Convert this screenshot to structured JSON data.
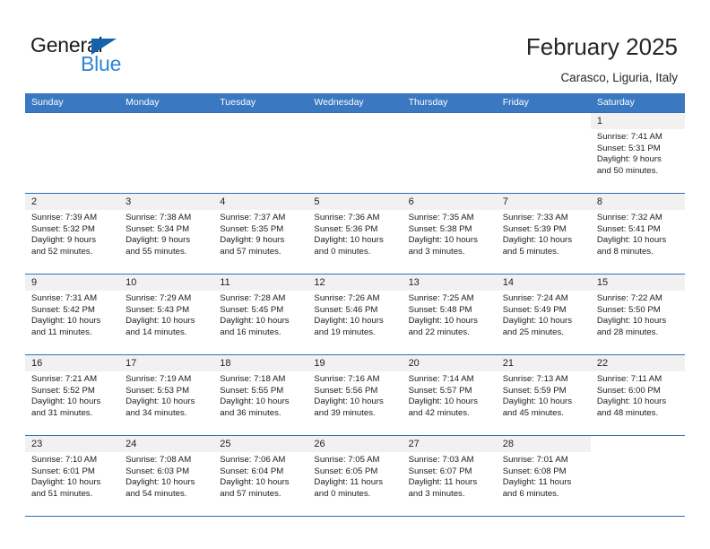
{
  "brand": {
    "name_part1": "General",
    "name_part2": "Blue",
    "triangle_color": "#1461ac",
    "blue_color": "#2e86d4"
  },
  "header": {
    "title": "February 2025",
    "subtitle": "Carasco, Liguria, Italy"
  },
  "theme": {
    "header_row_bg": "#3a78c2",
    "row_divider": "#2f6fba",
    "daynum_band_bg": "#f1f1f1",
    "text": "#1c1c1c"
  },
  "weekdays": [
    "Sunday",
    "Monday",
    "Tuesday",
    "Wednesday",
    "Thursday",
    "Friday",
    "Saturday"
  ],
  "weeks": [
    [
      {
        "day": "",
        "sunrise": "",
        "sunset": "",
        "daylight1": "",
        "daylight2": ""
      },
      {
        "day": "",
        "sunrise": "",
        "sunset": "",
        "daylight1": "",
        "daylight2": ""
      },
      {
        "day": "",
        "sunrise": "",
        "sunset": "",
        "daylight1": "",
        "daylight2": ""
      },
      {
        "day": "",
        "sunrise": "",
        "sunset": "",
        "daylight1": "",
        "daylight2": ""
      },
      {
        "day": "",
        "sunrise": "",
        "sunset": "",
        "daylight1": "",
        "daylight2": ""
      },
      {
        "day": "",
        "sunrise": "",
        "sunset": "",
        "daylight1": "",
        "daylight2": ""
      },
      {
        "day": "1",
        "sunrise": "Sunrise: 7:41 AM",
        "sunset": "Sunset: 5:31 PM",
        "daylight1": "Daylight: 9 hours",
        "daylight2": "and 50 minutes."
      }
    ],
    [
      {
        "day": "2",
        "sunrise": "Sunrise: 7:39 AM",
        "sunset": "Sunset: 5:32 PM",
        "daylight1": "Daylight: 9 hours",
        "daylight2": "and 52 minutes."
      },
      {
        "day": "3",
        "sunrise": "Sunrise: 7:38 AM",
        "sunset": "Sunset: 5:34 PM",
        "daylight1": "Daylight: 9 hours",
        "daylight2": "and 55 minutes."
      },
      {
        "day": "4",
        "sunrise": "Sunrise: 7:37 AM",
        "sunset": "Sunset: 5:35 PM",
        "daylight1": "Daylight: 9 hours",
        "daylight2": "and 57 minutes."
      },
      {
        "day": "5",
        "sunrise": "Sunrise: 7:36 AM",
        "sunset": "Sunset: 5:36 PM",
        "daylight1": "Daylight: 10 hours",
        "daylight2": "and 0 minutes."
      },
      {
        "day": "6",
        "sunrise": "Sunrise: 7:35 AM",
        "sunset": "Sunset: 5:38 PM",
        "daylight1": "Daylight: 10 hours",
        "daylight2": "and 3 minutes."
      },
      {
        "day": "7",
        "sunrise": "Sunrise: 7:33 AM",
        "sunset": "Sunset: 5:39 PM",
        "daylight1": "Daylight: 10 hours",
        "daylight2": "and 5 minutes."
      },
      {
        "day": "8",
        "sunrise": "Sunrise: 7:32 AM",
        "sunset": "Sunset: 5:41 PM",
        "daylight1": "Daylight: 10 hours",
        "daylight2": "and 8 minutes."
      }
    ],
    [
      {
        "day": "9",
        "sunrise": "Sunrise: 7:31 AM",
        "sunset": "Sunset: 5:42 PM",
        "daylight1": "Daylight: 10 hours",
        "daylight2": "and 11 minutes."
      },
      {
        "day": "10",
        "sunrise": "Sunrise: 7:29 AM",
        "sunset": "Sunset: 5:43 PM",
        "daylight1": "Daylight: 10 hours",
        "daylight2": "and 14 minutes."
      },
      {
        "day": "11",
        "sunrise": "Sunrise: 7:28 AM",
        "sunset": "Sunset: 5:45 PM",
        "daylight1": "Daylight: 10 hours",
        "daylight2": "and 16 minutes."
      },
      {
        "day": "12",
        "sunrise": "Sunrise: 7:26 AM",
        "sunset": "Sunset: 5:46 PM",
        "daylight1": "Daylight: 10 hours",
        "daylight2": "and 19 minutes."
      },
      {
        "day": "13",
        "sunrise": "Sunrise: 7:25 AM",
        "sunset": "Sunset: 5:48 PM",
        "daylight1": "Daylight: 10 hours",
        "daylight2": "and 22 minutes."
      },
      {
        "day": "14",
        "sunrise": "Sunrise: 7:24 AM",
        "sunset": "Sunset: 5:49 PM",
        "daylight1": "Daylight: 10 hours",
        "daylight2": "and 25 minutes."
      },
      {
        "day": "15",
        "sunrise": "Sunrise: 7:22 AM",
        "sunset": "Sunset: 5:50 PM",
        "daylight1": "Daylight: 10 hours",
        "daylight2": "and 28 minutes."
      }
    ],
    [
      {
        "day": "16",
        "sunrise": "Sunrise: 7:21 AM",
        "sunset": "Sunset: 5:52 PM",
        "daylight1": "Daylight: 10 hours",
        "daylight2": "and 31 minutes."
      },
      {
        "day": "17",
        "sunrise": "Sunrise: 7:19 AM",
        "sunset": "Sunset: 5:53 PM",
        "daylight1": "Daylight: 10 hours",
        "daylight2": "and 34 minutes."
      },
      {
        "day": "18",
        "sunrise": "Sunrise: 7:18 AM",
        "sunset": "Sunset: 5:55 PM",
        "daylight1": "Daylight: 10 hours",
        "daylight2": "and 36 minutes."
      },
      {
        "day": "19",
        "sunrise": "Sunrise: 7:16 AM",
        "sunset": "Sunset: 5:56 PM",
        "daylight1": "Daylight: 10 hours",
        "daylight2": "and 39 minutes."
      },
      {
        "day": "20",
        "sunrise": "Sunrise: 7:14 AM",
        "sunset": "Sunset: 5:57 PM",
        "daylight1": "Daylight: 10 hours",
        "daylight2": "and 42 minutes."
      },
      {
        "day": "21",
        "sunrise": "Sunrise: 7:13 AM",
        "sunset": "Sunset: 5:59 PM",
        "daylight1": "Daylight: 10 hours",
        "daylight2": "and 45 minutes."
      },
      {
        "day": "22",
        "sunrise": "Sunrise: 7:11 AM",
        "sunset": "Sunset: 6:00 PM",
        "daylight1": "Daylight: 10 hours",
        "daylight2": "and 48 minutes."
      }
    ],
    [
      {
        "day": "23",
        "sunrise": "Sunrise: 7:10 AM",
        "sunset": "Sunset: 6:01 PM",
        "daylight1": "Daylight: 10 hours",
        "daylight2": "and 51 minutes."
      },
      {
        "day": "24",
        "sunrise": "Sunrise: 7:08 AM",
        "sunset": "Sunset: 6:03 PM",
        "daylight1": "Daylight: 10 hours",
        "daylight2": "and 54 minutes."
      },
      {
        "day": "25",
        "sunrise": "Sunrise: 7:06 AM",
        "sunset": "Sunset: 6:04 PM",
        "daylight1": "Daylight: 10 hours",
        "daylight2": "and 57 minutes."
      },
      {
        "day": "26",
        "sunrise": "Sunrise: 7:05 AM",
        "sunset": "Sunset: 6:05 PM",
        "daylight1": "Daylight: 11 hours",
        "daylight2": "and 0 minutes."
      },
      {
        "day": "27",
        "sunrise": "Sunrise: 7:03 AM",
        "sunset": "Sunset: 6:07 PM",
        "daylight1": "Daylight: 11 hours",
        "daylight2": "and 3 minutes."
      },
      {
        "day": "28",
        "sunrise": "Sunrise: 7:01 AM",
        "sunset": "Sunset: 6:08 PM",
        "daylight1": "Daylight: 11 hours",
        "daylight2": "and 6 minutes."
      },
      {
        "day": "",
        "sunrise": "",
        "sunset": "",
        "daylight1": "",
        "daylight2": ""
      }
    ]
  ]
}
